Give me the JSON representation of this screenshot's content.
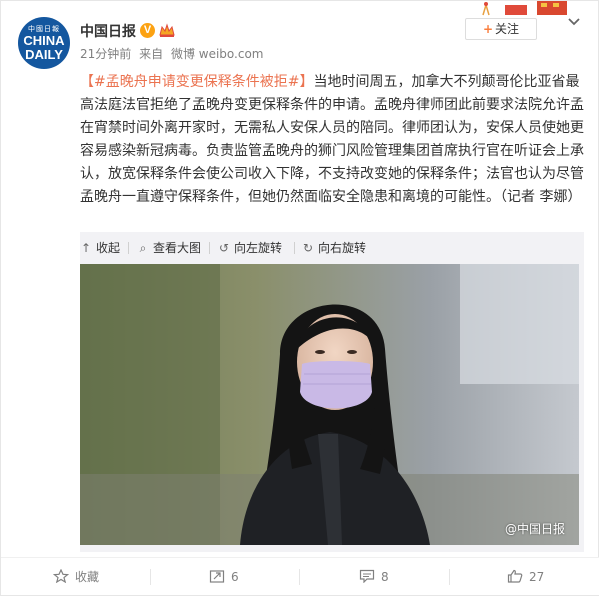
{
  "account": {
    "avatar_text_top": "中國日報",
    "avatar_text_mid": "CHINA",
    "avatar_text_bottom": "DAILY",
    "name": "中国日报",
    "verified_label": "V"
  },
  "meta": {
    "time": "21分钟前",
    "source_prefix": "来自",
    "source_app": "微博 weibo.com"
  },
  "follow_button": {
    "label": "关注"
  },
  "post": {
    "tag": "【#孟晚舟申请变更保释条件被拒#】",
    "text": "当地时间周五，加拿大不列颠哥伦比亚省最高法庭法官拒绝了孟晚舟变更保释条件的申请。孟晚舟律师团此前要求法院允许孟在宵禁时间外离开家时，无需私人安保人员的陪同。律师团认为，安保人员使她更容易感染新冠病毒。负责监管孟晚舟的狮门风险管理集团首席执行官在听证会上承认，放宽保释条件会使公司收入下降，不支持改变她的保释条件；法官也认为尽管孟晚舟一直遵守保释条件，但她仍然面临安全隐患和离境的可能性。（记者 李娜）"
  },
  "media_toolbar": {
    "collapse": "收起",
    "view_large": "查看大图",
    "rotate_left": "向左旋转",
    "rotate_right": "向右旋转"
  },
  "photo": {
    "watermark": "@中国日报"
  },
  "footer": {
    "favorite_label": "收藏",
    "repost_count": "6",
    "comment_count": "8",
    "like_count": "27"
  },
  "colors": {
    "accent": "#eb7350",
    "brand_blue": "#14579f",
    "verified": "#fca212"
  }
}
